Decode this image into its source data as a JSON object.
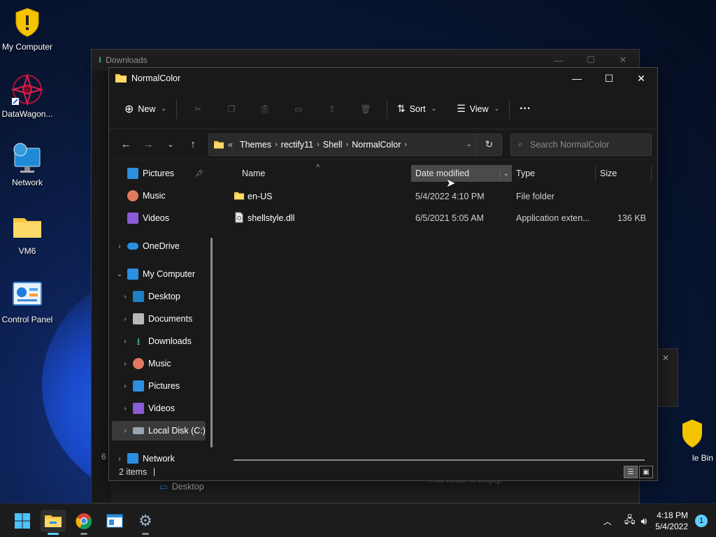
{
  "desktop": {
    "icons": [
      {
        "label": "My Computer",
        "icon": "shield-icon"
      },
      {
        "label": "DataWagon...",
        "icon": "mandala-icon"
      },
      {
        "label": "Network",
        "icon": "globe-monitor-icon"
      },
      {
        "label": "VM6",
        "icon": "folder-icon"
      },
      {
        "label": "Control Panel",
        "icon": "control-panel-icon"
      },
      {
        "label": "le Bin",
        "icon": "recycle-bin-icon"
      }
    ]
  },
  "background_window": {
    "title": "Downloads",
    "status_fragment": "6 i",
    "nav_item": "Desktop",
    "empty_text": "This folder is empty."
  },
  "window": {
    "title": "NormalColor",
    "controls": {
      "minimize": "—",
      "maximize": "☐",
      "close": "✕"
    }
  },
  "commandbar": {
    "new_label": "New",
    "sort_label": "Sort",
    "view_label": "View",
    "more_label": "···"
  },
  "address": {
    "overflow": "«",
    "crumbs": [
      "Themes",
      "rectify11",
      "Shell",
      "NormalColor"
    ]
  },
  "search": {
    "placeholder": "Search NormalColor"
  },
  "navpane": {
    "items": [
      {
        "label": "Pictures",
        "pinned": true
      },
      {
        "label": "Music"
      },
      {
        "label": "Videos"
      },
      {
        "label": "OneDrive"
      },
      {
        "label": "My Computer"
      },
      {
        "label": "Desktop"
      },
      {
        "label": "Documents"
      },
      {
        "label": "Downloads"
      },
      {
        "label": "Music"
      },
      {
        "label": "Pictures"
      },
      {
        "label": "Videos"
      },
      {
        "label": "Local Disk (C:)"
      },
      {
        "label": "Network"
      }
    ]
  },
  "columns": {
    "name": "Name",
    "date": "Date modified",
    "type": "Type",
    "size": "Size"
  },
  "files": [
    {
      "name": "en-US",
      "date": "5/4/2022 4:10 PM",
      "type": "File folder",
      "size": ""
    },
    {
      "name": "shellstyle.dll",
      "date": "6/5/2021 5:05 AM",
      "type": "Application exten...",
      "size": "136 KB"
    }
  ],
  "status": {
    "count": "2 items"
  },
  "taskbar": {
    "time": "4:18 PM",
    "date": "5/4/2022",
    "notifications": "1"
  },
  "colors": {
    "accent": "#60cdff",
    "folder": "#f6c744",
    "window_bg": "#191919"
  }
}
